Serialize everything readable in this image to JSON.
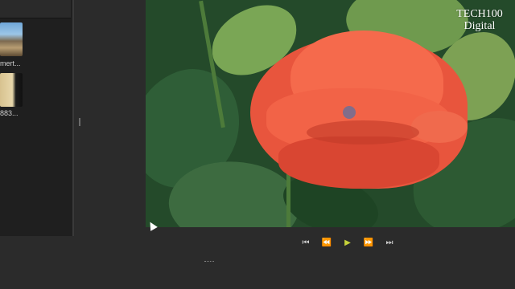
{
  "media_bin": {
    "items": [
      {
        "label": "mert...",
        "icon": "image-thumbnail-icon"
      },
      {
        "label": "883...",
        "icon": "image-thumbnail-icon"
      }
    ]
  },
  "preview": {
    "watermark": {
      "line1": "TECH100",
      "line2": "Digital"
    }
  },
  "playback": {
    "buttons": [
      {
        "name": "skip-to-start",
        "glyph": "⏮"
      },
      {
        "name": "step-back",
        "glyph": "⏪"
      },
      {
        "name": "play",
        "glyph": "▶"
      },
      {
        "name": "step-forward",
        "glyph": "⏩"
      },
      {
        "name": "skip-to-end",
        "glyph": "⏭"
      }
    ],
    "play_color": "#c7d33a"
  }
}
